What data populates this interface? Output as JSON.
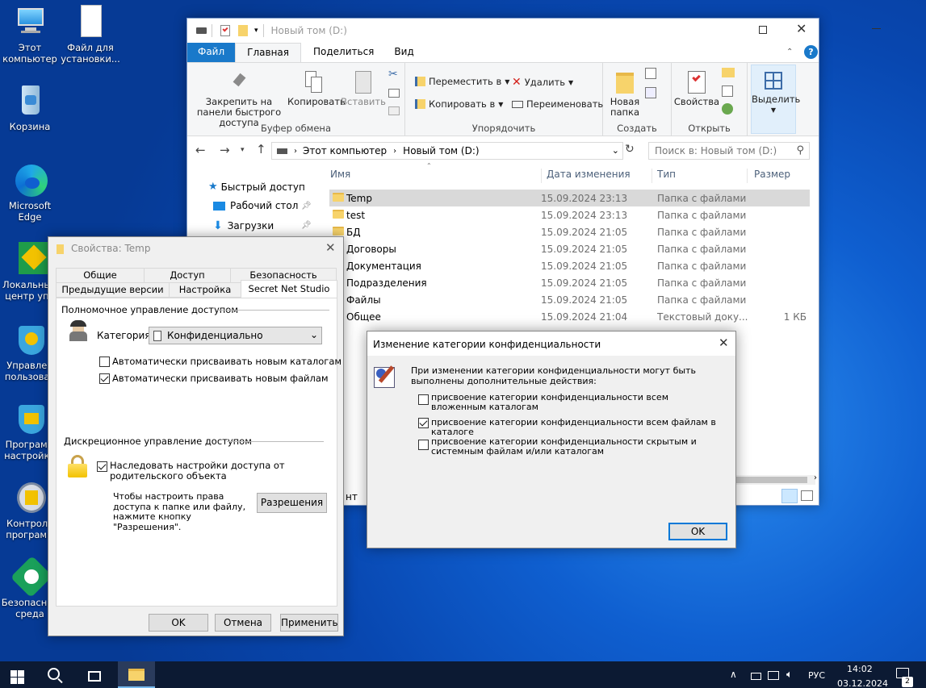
{
  "desktop": {
    "icons": [
      {
        "label": "Этот компьютер"
      },
      {
        "label": "Файл для установки..."
      },
      {
        "label": "Корзина"
      },
      {
        "label": "Microsoft Edge"
      },
      {
        "label": "Локальный центр упр"
      },
      {
        "label": "Управлен пользоват"
      },
      {
        "label": "Программ настройки"
      },
      {
        "label": "Контроль программ"
      },
      {
        "label": "Безопасная среда"
      }
    ]
  },
  "explorer": {
    "title": "Новый том (D:)",
    "tabs": [
      "Файл",
      "Главная",
      "Поделиться",
      "Вид"
    ],
    "ribbon": {
      "pin": "Закрепить на панели быстрого доступа",
      "copy": "Копировать",
      "paste": "Вставить",
      "clipboard_group": "Буфер обмена",
      "move_to": "Переместить в",
      "copy_to": "Копировать в",
      "delete": "Удалить",
      "rename": "Переименовать",
      "organize_group": "Упорядочить",
      "new_folder": "Новая папка",
      "create_group": "Создать",
      "properties": "Свойства",
      "open_group": "Открыть",
      "select": "Выделить"
    },
    "address": {
      "crumb1": "Этот компьютер",
      "crumb2": "Новый том (D:)",
      "search_placeholder": "Поиск в: Новый том (D:)"
    },
    "nav": {
      "quick": "Быстрый доступ",
      "desktop": "Рабочий стол",
      "downloads": "Загрузки"
    },
    "columns": {
      "name": "Имя",
      "date": "Дата изменения",
      "type": "Тип",
      "size": "Размер"
    },
    "files": [
      {
        "name": "Temp",
        "date": "15.09.2024 23:13",
        "type": "Папка с файлами",
        "size": ""
      },
      {
        "name": "test",
        "date": "15.09.2024 23:13",
        "type": "Папка с файлами",
        "size": ""
      },
      {
        "name": "БД",
        "date": "15.09.2024 21:05",
        "type": "Папка с файлами",
        "size": ""
      },
      {
        "name": "Договоры",
        "date": "15.09.2024 21:05",
        "type": "Папка с файлами",
        "size": ""
      },
      {
        "name": "Документация",
        "date": "15.09.2024 21:05",
        "type": "Папка с файлами",
        "size": ""
      },
      {
        "name": "Подразделения",
        "date": "15.09.2024 21:05",
        "type": "Папка с файлами",
        "size": ""
      },
      {
        "name": "Файлы",
        "date": "15.09.2024 21:05",
        "type": "Папка с файлами",
        "size": ""
      },
      {
        "name": "Общее",
        "date": "15.09.2024 21:04",
        "type": "Текстовый доку...",
        "size": "1 КБ"
      }
    ],
    "status_partial": "нт"
  },
  "props": {
    "title": "Свойства: Temp",
    "tabs_row1": [
      "Общие",
      "Доступ",
      "Безопасность"
    ],
    "tabs_row2": [
      "Предыдущие версии",
      "Настройка",
      "Secret Net Studio"
    ],
    "mandatory_header": "Полномочное управление доступом",
    "category_label": "Категория:",
    "category_value": "Конфиденциально",
    "auto_dirs": "Автоматически присваивать новым каталогам",
    "auto_files": "Автоматически присваивать новым файлам",
    "discretionary_header": "Дискреционное управление доступом",
    "inherit": "Наследовать настройки доступа от родительского объекта",
    "hint": "Чтобы настроить права доступа к папке или файлу, нажмите кнопку \"Разрешения\".",
    "permissions_btn": "Разрешения",
    "ok": "OK",
    "cancel": "Отмена",
    "apply": "Применить"
  },
  "conf": {
    "title": "Изменение категории конфиденциальности",
    "intro": "При изменении категории конфиденциальности могут быть выполнены дополнительные действия:",
    "opt1": "присвоение категории конфиденциальности всем вложенным каталогам",
    "opt2": "присвоение категории конфиденциальности всем файлам в каталоге",
    "opt3": "присвоение категории конфиденциальности скрытым и системным файлам и/или каталогам",
    "ok": "OK"
  },
  "taskbar": {
    "lang": "РУС",
    "time": "14:02",
    "date": "03.12.2024",
    "notif_count": "2"
  },
  "colors": {
    "accent": "#1979ca",
    "selection": "#cce8ff",
    "hover_row": "#d9d9d9"
  }
}
